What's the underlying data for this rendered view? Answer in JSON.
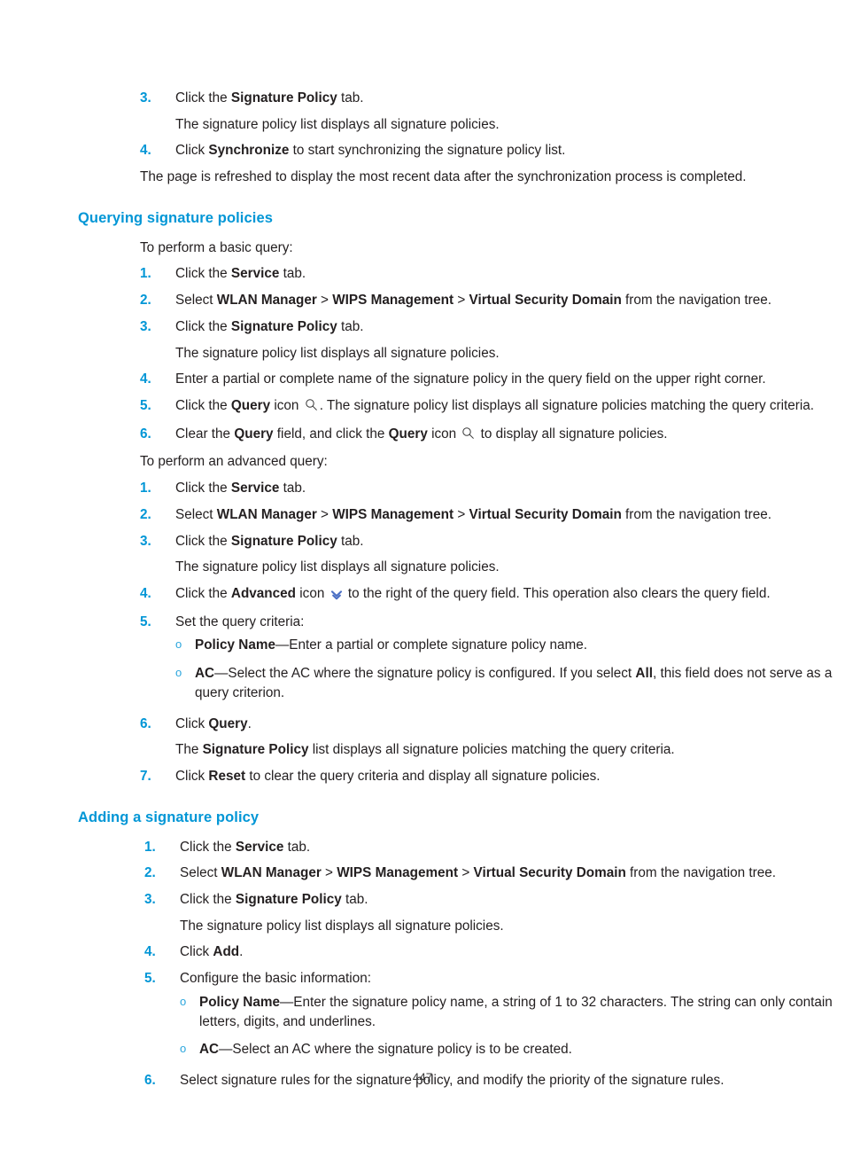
{
  "document": {
    "page_number": "447",
    "accent_color": "#0096d6",
    "text_color": "#231f20",
    "background": "#ffffff"
  },
  "icons": {
    "query_icon": "search-icon",
    "advanced_icon": "double-chevron-down-icon",
    "sub_bullet_marker": "o"
  },
  "top_block": {
    "step3": {
      "num": "3.",
      "pre": "Click the ",
      "bold": "Signature Policy",
      "post": " tab."
    },
    "step3_result": "The signature policy list displays all signature policies.",
    "step4": {
      "num": "4.",
      "pre": "Click ",
      "bold": "Synchronize",
      "post": " to start synchronizing the signature policy list."
    },
    "closing": "The page is refreshed to display the most recent data after the synchronization process is completed."
  },
  "section_query": {
    "heading": "Querying signature policies",
    "basic_intro": "To perform a basic query:",
    "basic_steps": {
      "s1": {
        "num": "1.",
        "pre": "Click the ",
        "bold": "Service",
        "post": " tab."
      },
      "s2": {
        "num": "2.",
        "pre": "Select ",
        "b1": "WLAN Manager",
        "sep1": " > ",
        "b2": "WIPS Management",
        "sep2": " > ",
        "b3": "Virtual Security Domain",
        "post": " from the navigation tree."
      },
      "s3": {
        "num": "3.",
        "pre": "Click the ",
        "bold": "Signature Policy",
        "post": " tab."
      },
      "s3_result": "The signature policy list displays all signature policies.",
      "s4": {
        "num": "4.",
        "text": "Enter a partial or complete name of the signature policy in the query field on the upper right corner."
      },
      "s5": {
        "num": "5.",
        "pre": "Click the ",
        "bold": "Query",
        "mid": " icon ",
        "post": ". The signature policy list displays all signature policies matching the query criteria."
      },
      "s6": {
        "num": "6.",
        "pre": "Clear the ",
        "b1": "Query",
        "mid1": " field, and click the ",
        "b2": "Query",
        "mid2": " icon ",
        "post": " to display all signature policies."
      }
    },
    "advanced_intro": "To perform an advanced query:",
    "advanced_steps": {
      "s1": {
        "num": "1.",
        "pre": "Click the ",
        "bold": "Service",
        "post": " tab."
      },
      "s2": {
        "num": "2.",
        "pre": "Select ",
        "b1": "WLAN Manager",
        "sep1": " > ",
        "b2": "WIPS Management",
        "sep2": " > ",
        "b3": "Virtual Security Domain",
        "post": " from the navigation tree."
      },
      "s3": {
        "num": "3.",
        "pre": "Click the ",
        "bold": "Signature Policy",
        "post": " tab."
      },
      "s3_result": "The signature policy list displays all signature policies.",
      "s4": {
        "num": "4.",
        "pre": "Click the ",
        "bold": "Advanced",
        "mid": " icon ",
        "post": " to the right of the query field. This operation also clears the query field."
      },
      "s5": {
        "num": "5.",
        "text": "Set the query criteria:"
      },
      "s5_subs": {
        "a": {
          "bold": "Policy Name",
          "post": "—Enter a partial or complete signature policy name."
        },
        "b": {
          "bold": "AC",
          "mid": "—Select the AC where the signature policy is configured. If you select ",
          "boldall": "All",
          "post": ", this field does not serve as a query criterion."
        }
      },
      "s6": {
        "num": "6.",
        "pre": "Click ",
        "bold": "Query",
        "post": "."
      },
      "s6_result": {
        "pre": "The ",
        "bold": "Signature Policy",
        "post": " list displays all signature policies matching the query criteria."
      },
      "s7": {
        "num": "7.",
        "pre": "Click ",
        "bold": "Reset",
        "post": " to clear the query criteria and display all signature policies."
      }
    }
  },
  "section_add": {
    "heading": "Adding a signature policy",
    "steps": {
      "s1": {
        "num": "1.",
        "pre": "Click the ",
        "bold": "Service",
        "post": " tab."
      },
      "s2": {
        "num": "2.",
        "pre": "Select ",
        "b1": "WLAN Manager",
        "sep1": " > ",
        "b2": "WIPS Management",
        "sep2": " > ",
        "b3": "Virtual Security Domain",
        "post": " from the navigation tree."
      },
      "s3": {
        "num": "3.",
        "pre": "Click the ",
        "bold": "Signature Policy",
        "post": " tab."
      },
      "s3_result": "The signature policy list displays all signature policies.",
      "s4": {
        "num": "4.",
        "pre": "Click ",
        "bold": "Add",
        "post": "."
      },
      "s5": {
        "num": "5.",
        "text": "Configure the basic information:"
      },
      "s5_subs": {
        "a": {
          "bold": "Policy Name",
          "post": "—Enter the signature policy name, a string of 1 to 32 characters. The string can only contain letters, digits, and underlines."
        },
        "b": {
          "bold": "AC",
          "post": "—Select an AC where the signature policy is to be created."
        }
      },
      "s6": {
        "num": "6.",
        "text": "Select signature rules for the signature policy, and modify the priority of the signature rules."
      }
    }
  }
}
